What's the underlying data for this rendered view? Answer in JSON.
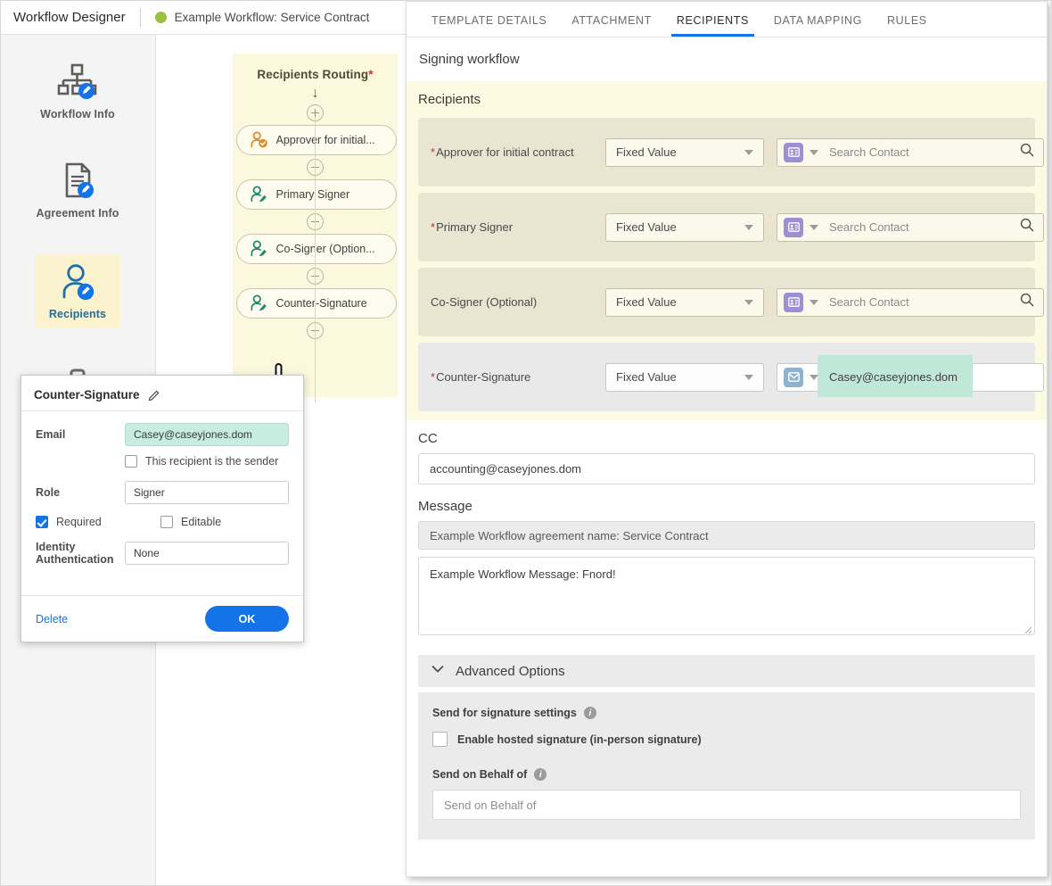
{
  "header": {
    "app_title": "Workflow Designer",
    "workflow_name": "Example Workflow: Service Contract",
    "status_dot_color": "#9ac23c"
  },
  "sidebar": {
    "items": [
      {
        "label": "Workflow Info",
        "icon": "org-chart-edit-icon",
        "active": false
      },
      {
        "label": "Agreement Info",
        "icon": "document-edit-icon",
        "active": false
      },
      {
        "label": "Recipients",
        "icon": "user-edit-icon",
        "active": true
      },
      {
        "label": "",
        "icon": "briefcase-icon",
        "active": false
      }
    ]
  },
  "canvas": {
    "flow_title": "Recipients Routing",
    "flow_title_required": "*",
    "nodes": [
      {
        "label": "Approver for initial...",
        "icon": "user-approve-icon",
        "color": "#e08a28"
      },
      {
        "label": "Primary Signer",
        "icon": "user-sign-icon",
        "color": "#1e8a6a"
      },
      {
        "label": "Co-Signer (Option...",
        "icon": "user-sign-icon",
        "color": "#1e8a6a"
      },
      {
        "label": "Counter-Signature",
        "icon": "user-sign-icon",
        "color": "#1e8a6a"
      }
    ]
  },
  "popup": {
    "title": "Counter-Signature",
    "edit_icon": "pencil-icon",
    "email_label": "Email",
    "email_value": "Casey@caseyjones.dom",
    "sender_checkbox_label": "This recipient is the sender",
    "sender_checked": false,
    "role_label": "Role",
    "role_value": "Signer",
    "required_label": "Required",
    "required_checked": true,
    "editable_label": "Editable",
    "editable_checked": false,
    "identity_label_line1": "Identity",
    "identity_label_line2": "Authentication",
    "identity_value": "None",
    "delete_label": "Delete",
    "ok_label": "OK",
    "accent_color": "#1473e6",
    "highlight_color": "#c7ece0"
  },
  "right_panel": {
    "tabs": [
      {
        "label": "TEMPLATE DETAILS",
        "active": false
      },
      {
        "label": "ATTACHMENT",
        "active": false
      },
      {
        "label": "RECIPIENTS",
        "active": true
      },
      {
        "label": "DATA MAPPING",
        "active": false
      },
      {
        "label": "RULES",
        "active": false
      }
    ],
    "active_tab_color": "#1473e6",
    "signing_workflow_title": "Signing workflow",
    "recipients_title": "Recipients",
    "recipients": [
      {
        "label": "Approver for initial contract",
        "required": true,
        "source": "Fixed Value",
        "source_options": [
          "Fixed Value"
        ],
        "contact_icon": "contact-card-icon",
        "contact_placeholder": "Search Contact",
        "contact_value": "",
        "search_icon": "search-icon",
        "style": "tan",
        "highlighted": false
      },
      {
        "label": "Primary Signer",
        "required": true,
        "source": "Fixed Value",
        "source_options": [
          "Fixed Value"
        ],
        "contact_icon": "contact-card-icon",
        "contact_placeholder": "Search Contact",
        "contact_value": "",
        "search_icon": "search-icon",
        "style": "tan",
        "highlighted": false
      },
      {
        "label": "Co-Signer (Optional)",
        "required": false,
        "source": "Fixed Value",
        "source_options": [
          "Fixed Value"
        ],
        "contact_icon": "contact-card-icon",
        "contact_placeholder": "Search Contact",
        "contact_value": "",
        "search_icon": "search-icon",
        "style": "tan",
        "highlighted": false
      },
      {
        "label": "Counter-Signature",
        "required": true,
        "source": "Fixed Value",
        "source_options": [
          "Fixed Value"
        ],
        "contact_icon": "envelope-icon",
        "contact_placeholder": "",
        "contact_value": "Casey@caseyjones.dom",
        "search_icon": "",
        "style": "gray",
        "highlighted": true
      }
    ],
    "cc": {
      "title": "CC",
      "value": "accounting@caseyjones.dom"
    },
    "message": {
      "title": "Message",
      "subject_value": "Example Workflow agreement name: Service Contract",
      "body_value": "Example Workflow Message: Fnord!"
    },
    "advanced": {
      "title": "Advanced Options",
      "chevron_icon": "chevron-down-icon",
      "send_settings_label": "Send for signature settings",
      "send_settings_info_icon": "info-icon",
      "hosted_signature_label": "Enable hosted signature (in-person signature)",
      "hosted_signature_checked": false,
      "send_on_behalf_label": "Send on Behalf of",
      "send_on_behalf_info_icon": "info-icon",
      "send_on_behalf_placeholder": "Send on Behalf of"
    }
  }
}
